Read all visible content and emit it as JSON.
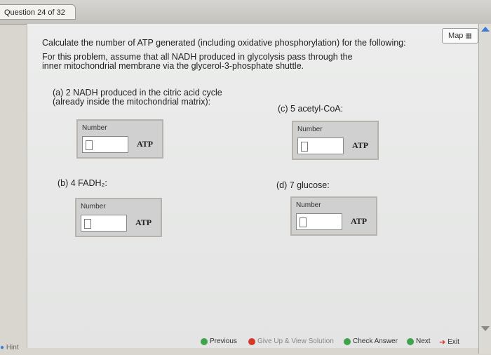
{
  "header": {
    "question_label": "Question 24 of 32"
  },
  "map_button": {
    "label": "Map"
  },
  "prompt": {
    "line1": "Calculate the number of ATP generated (including oxidative phosphorylation) for the following:",
    "line2": "For this problem, assume that all NADH produced in glycolysis pass through the",
    "line3": "inner mitochondrial membrane via the glycerol-3-phosphate shuttle."
  },
  "parts": {
    "a": {
      "line1": "(a) 2 NADH produced in the citric acid cycle",
      "line2": "(already inside the mitochondrial matrix):",
      "field_label": "Number",
      "unit": "ATP",
      "value": ""
    },
    "b": {
      "line1": "(b) 4 FADH₂:",
      "field_label": "Number",
      "unit": "ATP",
      "value": ""
    },
    "c": {
      "line1": "(c) 5 acetyl-CoA:",
      "field_label": "Number",
      "unit": "ATP",
      "value": ""
    },
    "d": {
      "line1": "(d) 7 glucose:",
      "field_label": "Number",
      "unit": "ATP",
      "value": ""
    }
  },
  "bottom": {
    "previous": "Previous",
    "give_up": "Give Up & View Solution",
    "check": "Check Answer",
    "next": "Next",
    "exit": "Exit",
    "hint": "Hint"
  },
  "colors": {
    "green": "#3fa34d",
    "red": "#d23a2a",
    "blue": "#3a7bd5"
  }
}
